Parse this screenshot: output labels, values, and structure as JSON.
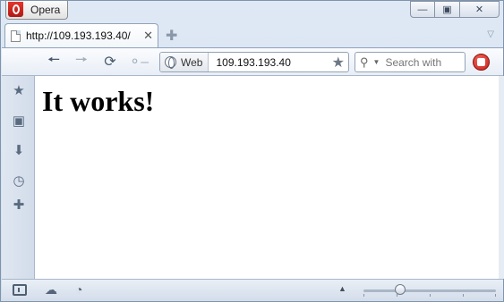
{
  "menu": {
    "label": "Opera",
    "logo_icon": "opera-logo-icon"
  },
  "window_controls": {
    "minimize_icon": "minimize-icon",
    "maximize_icon": "maximize-icon",
    "close_icon": "close-icon"
  },
  "tabs": [
    {
      "label": "http://109.193.193.40/",
      "close_icon": "close-icon"
    }
  ],
  "toolbar": {
    "back_icon": "arrow-left-icon",
    "forward_icon": "arrow-right-icon",
    "reload_icon": "reload-icon",
    "wand_icon": "key-icon",
    "address_badge": "Web",
    "address_value": "109.193.193.40",
    "search_placeholder": "Search with"
  },
  "sidebar": {
    "items": [
      "bookmarks-icon",
      "notes-icon",
      "downloads-icon",
      "history-icon",
      "add-panel-icon"
    ]
  },
  "page": {
    "heading": "It works!"
  },
  "status_bar": {
    "icons": [
      "panel-toggle-icon",
      "opera-unite-icon",
      "turbo-icon"
    ],
    "zoom_fraction": 0.28
  },
  "colors": {
    "accent_red": "#c81d14",
    "chrome_blue": "#dfe9f5"
  }
}
